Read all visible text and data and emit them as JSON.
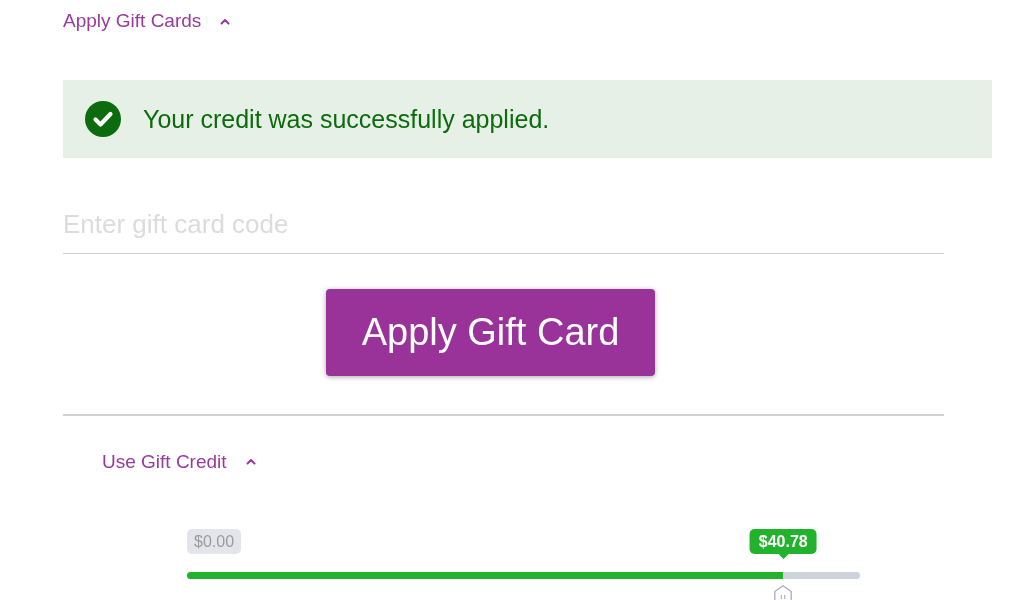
{
  "gift_cards_section": {
    "title": "Apply Gift Cards",
    "expanded": true
  },
  "alert": {
    "kind": "success",
    "message": "Your credit was successfully applied."
  },
  "gift_card_form": {
    "code_field": {
      "placeholder": "Enter gift card code"
    },
    "submit_button": "Apply Gift Card"
  },
  "gift_credit_section": {
    "title": "Use Gift Credit",
    "expanded": true,
    "slider": {
      "min_label": "$0.00",
      "value_label": "$40.78",
      "level": 0.886
    }
  }
}
